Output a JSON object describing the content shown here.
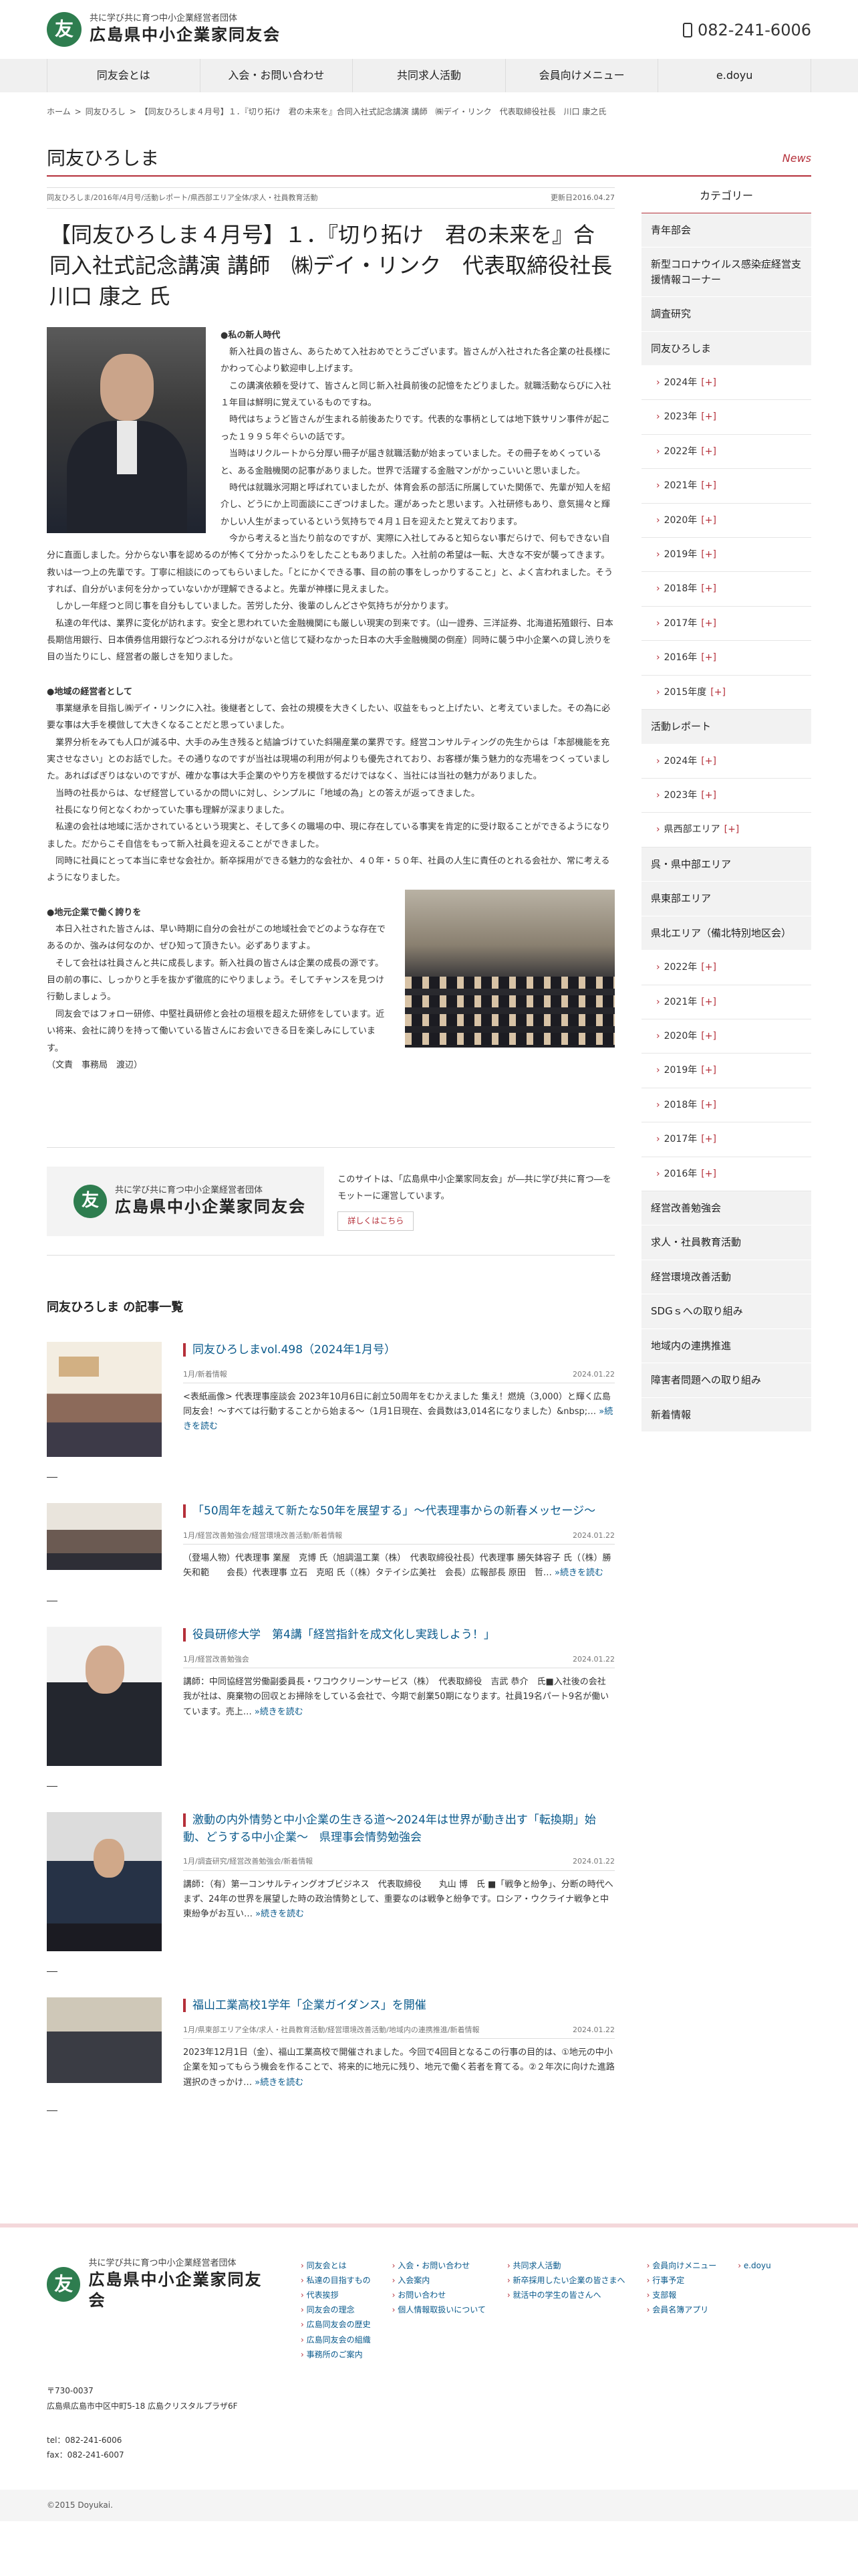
{
  "header": {
    "tagline": "共に学び共に育つ中小企業経営者団体",
    "org_name": "広島県中小企業家同友会",
    "logo_mark": "友",
    "tel": "082-241-6006"
  },
  "nav": [
    "同友会とは",
    "入会・お問い合わせ",
    "共同求人活動",
    "会員向けメニュー",
    "e.doyu"
  ],
  "breadcrumb": [
    "ホーム",
    "同友ひろし",
    "【同友ひろしま４月号】１．『切り拓け　君の未来を』合同入社式記念講演 講師　㈱デイ・リンク　代表取締役社長　川口 康之氏"
  ],
  "section": {
    "title": "同友ひろしま",
    "news_label": "News"
  },
  "article": {
    "categories": "同友ひろしま/2016年/4月号/活動レポート/県西部エリア全体/求人・社員教育活動",
    "updated": "更新日2016.04.27",
    "title": "【同友ひろしま４月号】１．『切り拓け　君の未来を』合同入社式記念講演 講師　㈱デイ・リンク　代表取締役社長　川口 康之 氏",
    "h_first": "●私の新人時代",
    "p1": "　新入社員の皆さん、あらためて入社おめでとうございます。皆さんが入社された各企業の社長様にかわって心より歓迎申し上げます。",
    "p2": "　この講演依頼を受けて、皆さんと同じ新入社員前後の記憶をたどりました。就職活動ならびに入社１年目は鮮明に覚えているものですね。",
    "p3": "　時代はちょうど皆さんが生まれる前後あたりです。代表的な事柄としては地下鉄サリン事件が起こった１９９５年ぐらいの話です。",
    "p4": "　当時はリクルートから分厚い冊子が届き就職活動が始まっていました。その冊子をめくっていると、ある金融機関の記事がありました。世界で活躍する金融マンがかっこいいと思いました。",
    "p5": "　時代は就職氷河期と呼ばれていましたが、体育会系の部活に所属していた関係で、先輩が知人を紹介し、どうにか上司面談にこぎつけました。運があったと思います。入社研修もあり、意気揚々と輝かしい人生がまっているという気持ちで４月１日を迎えたと覚えております。",
    "p6": "　今から考えると当たり前なのですが、実際に入社してみると知らない事だらけで、何もできない自分に直面しました。分からない事を認めるのが怖くて分かったふりをしたこともありました。入社前の希望は一転、大きな不安が襲ってきます。救いは一つ上の先輩です。丁寧に相談にのってもらいました。「とにかくできる事、目の前の事をしっかりすること」と、よく言われました。そうすれば、自分がいま何を分かっていないかが理解できるよと。先輩が神様に見えました。",
    "p7": "　しかし一年経つと同じ事を自分もしていました。苦労した分、後輩のしんどさや気持ちが分かります。",
    "p8": "　私達の年代は、業界に変化が訪れます。安全と思われていた金融機関にも厳しい現実の到来です。（山一證券、三洋証券、北海道拓殖銀行、日本長期信用銀行、日本債券信用銀行などつぶれる分けがないと信じて疑わなかった日本の大手金融機関の倒産）同時に襲う中小企業への貸し渋りを目の当たりにし、経営者の厳しさを知りました。",
    "h_second": "●地域の経営者として",
    "p9": "　事業継承を目指し㈱デイ・リンクに入社。後継者として、会社の規模を大きくしたい、収益をもっと上げたい、と考えていました。その為に必要な事は大手を模倣して大きくなることだと思っていました。",
    "p10": "　業界分析をみても人口が減る中、大手のみ生き残ると結論づけていた斜陽産業の業界です。経営コンサルティングの先生からは「本部機能を充実させなさい」とのお話でした。その通りなのですが当社は現場の利用が何よりも優先されており、お客様が集う魅力的な売場をつくっていました。あればぱぎりはないのですが、確かな事は大手企業のやり方を模倣するだけではなく、当社には当社の魅力がありました。",
    "p11": "　当時の社長からは、なぜ経営しているかの問いに対し、シンプルに「地域の為」との答えが返ってきました。",
    "p12": "　社長になり何となくわかっていた事も理解が深まりました。",
    "p13": "　私達の会社は地域に活かされているという現実と、そして多くの職場の中、現に存在している事実を肯定的に受け取ることができるようになりました。だからこそ自信をもって新入社員を迎えることができました。",
    "p14": "　同時に社員にとって本当に幸せな会社か。新卒採用ができる魅力的な会社か、４０年・５０年、社員の人生に責任のとれる会社か、常に考えるようになりました。",
    "h_third": "●地元企業で働く誇りを",
    "p15": "　本日入社された皆さんは、早い時期に自分の会社がこの地域社会でどのような存在であるのか、強みは何なのか、ぜひ知って頂きたい。必ずありますよ。",
    "p16": "　そして会社は社員さんと共に成長します。新入社員の皆さんは企業の成長の源です。目の前の事に、しっかりと手を抜かず徹底的にやりましょう。そしてチャンスを見つけ行動しましょう。",
    "p17": "　同友会ではフォロー研修、中堅社員研修と会社の垣根を超えた研修をしています。近い将来、会社に誇りを持って働いている皆さんにお会いできる日を楽しみにしています。",
    "signature": "（文責　事務局　渡辺）"
  },
  "about": {
    "tagline": "共に学び共に育つ中小企業経営者団体",
    "org_name": "広島県中小企業家同友会",
    "text": "このサイトは、「広島県中小企業家同友会」が―共に学び共に育つ―をモットーに運営しています。",
    "button": "詳しくはこちら"
  },
  "list": {
    "heading": "同友ひろしま の記事一覧",
    "items": [
      {
        "title": "同友ひろしまvol.498（2024年1月号）",
        "cats": "1月/新着情報",
        "date": "2024.01.22",
        "excerpt": "<表紙画像> 代表理事座談会 2023年10月6日に創立50周年をむかえました 集え！燃焼（3,000）と輝く広島同友会！～すべては行動することから始まる～（1月1日現在、会員数は3,014名になりました）&nbsp;…",
        "more": "»続きを読む"
      },
      {
        "title": "「50周年を越えて新たな50年を展望する」～代表理事からの新春メッセージ～",
        "cats": "1月/経営改善勉強会/経営環境改善活動/新着情報",
        "date": "2024.01.22",
        "excerpt": "（登場人物）代表理事 業屋　克博 氏（旭調温工業（株）　代表取締役社長）代表理事 勝矢鉢容子 氏（（株）勝矢和範　　会長）代表理事 立石　克昭 氏（（株）タテイシ広美社　会長）広報部長 原田　哲…",
        "more": "»続きを読む"
      },
      {
        "title": "役員研修大学　第4講「経営指針を成文化し実践しよう！」",
        "cats": "1月/経営改善勉強会",
        "date": "2024.01.22",
        "excerpt": "講師：中同協経営労働副委員長・ワコウクリーンサービス（株）　代表取締役　吉武 恭介　氏■入社後の会社 我が社は、廃棄物の回収とお掃除をしている会社で、今期で創業50期になります。社員19名パート9名が働いています。売上…",
        "more": "»続きを読む"
      },
      {
        "title": "激動の内外情勢と中小企業の生きる道～2024年は世界が動き出す「転換期」始動、どうする中小企業～　県理事会情勢勉強会",
        "cats": "1月/調査研究/経営改善勉強会/新着情報",
        "date": "2024.01.22",
        "excerpt": "講師：（有）第一コンサルティングオブビジネス　代表取締役　　丸山 博　氏 ■「戦争と紛争」、分断の時代へ まず、24年の世界を展望した時の政治情勢として、重要なのは戦争と紛争です。ロシア・ウクライナ戦争と中東紛争がお互い…",
        "more": "»続きを読む"
      },
      {
        "title": "福山工業高校1学年「企業ガイダンス」を開催",
        "cats": "1月/県東部エリア全体/求人・社員教育活動/経営環境改善活動/地域内の連携推進/新着情報",
        "date": "2024.01.22",
        "excerpt": "2023年12月1日（金）、福山工業高校で開催されました。今回で4回目となるこの行事の目的は、①地元の中小企業を知ってもらう機会を作ることで、将来的に地元に残り、地元で働く若者を育てる。②２年次に向けた進路選択のきっかけ…",
        "more": "»続きを読む"
      }
    ]
  },
  "sidebar": {
    "heading": "カテゴリー",
    "items": [
      {
        "label": "青年部会",
        "type": "main"
      },
      {
        "label": "新型コロナウイルス感染症経営支援情報コーナー",
        "type": "main"
      },
      {
        "label": "調査研究",
        "type": "main"
      },
      {
        "label": "同友ひろしま",
        "type": "main"
      },
      {
        "label": "2024年",
        "type": "sub"
      },
      {
        "label": "2023年",
        "type": "sub"
      },
      {
        "label": "2022年",
        "type": "sub"
      },
      {
        "label": "2021年",
        "type": "sub"
      },
      {
        "label": "2020年",
        "type": "sub"
      },
      {
        "label": "2019年",
        "type": "sub"
      },
      {
        "label": "2018年",
        "type": "sub"
      },
      {
        "label": "2017年",
        "type": "sub"
      },
      {
        "label": "2016年",
        "type": "sub"
      },
      {
        "label": "2015年度",
        "type": "sub"
      },
      {
        "label": "活動レポート",
        "type": "main"
      },
      {
        "label": "2024年",
        "type": "sub"
      },
      {
        "label": "2023年",
        "type": "sub"
      },
      {
        "label": "県西部エリア",
        "type": "sub"
      },
      {
        "label": "呉・県中部エリア",
        "type": "main"
      },
      {
        "label": "県東部エリア",
        "type": "main"
      },
      {
        "label": "県北エリア（備北特別地区会）",
        "type": "main"
      },
      {
        "label": "2022年",
        "type": "sub"
      },
      {
        "label": "2021年",
        "type": "sub"
      },
      {
        "label": "2020年",
        "type": "sub"
      },
      {
        "label": "2019年",
        "type": "sub"
      },
      {
        "label": "2018年",
        "type": "sub"
      },
      {
        "label": "2017年",
        "type": "sub"
      },
      {
        "label": "2016年",
        "type": "sub"
      },
      {
        "label": "経営改善勉強会",
        "type": "main"
      },
      {
        "label": "求人・社員教育活動",
        "type": "main"
      },
      {
        "label": "経営環境改善活動",
        "type": "main"
      },
      {
        "label": "SDGｓへの取り組み",
        "type": "main"
      },
      {
        "label": "地域内の連携推進",
        "type": "main"
      },
      {
        "label": "障害者問題への取り組み",
        "type": "main"
      },
      {
        "label": "新着情報",
        "type": "main"
      }
    ],
    "plus": "[+]"
  },
  "footer": {
    "tagline": "共に学び共に育つ中小企業経営者団体",
    "org_name": "広島県中小企業家同友会",
    "cols": [
      [
        "同友会とは",
        "私達の目指すもの",
        "代表挨拶",
        "同友会の理念",
        "広島同友会の歴史",
        "広島同友会の組織",
        "事務所のご案内"
      ],
      [
        "入会・お問い合わせ",
        "入会案内",
        "お問い合わせ",
        "個人情報取扱いについて"
      ],
      [
        "共同求人活動",
        "新卒採用したい企業の皆さまへ",
        "就活中の学生の皆さんへ"
      ],
      [
        "会員向けメニュー",
        "行事予定",
        "支部報",
        "会員名簿アプリ"
      ],
      [
        "e.doyu"
      ]
    ],
    "postal": "〒730-0037",
    "address": "広島県広島市中区中町5-18 広島クリスタルプラザ6F",
    "tel": "tel：082-241-6006",
    "fax": "fax：082-241-6007",
    "copyright": "©2015 Doyukai."
  }
}
